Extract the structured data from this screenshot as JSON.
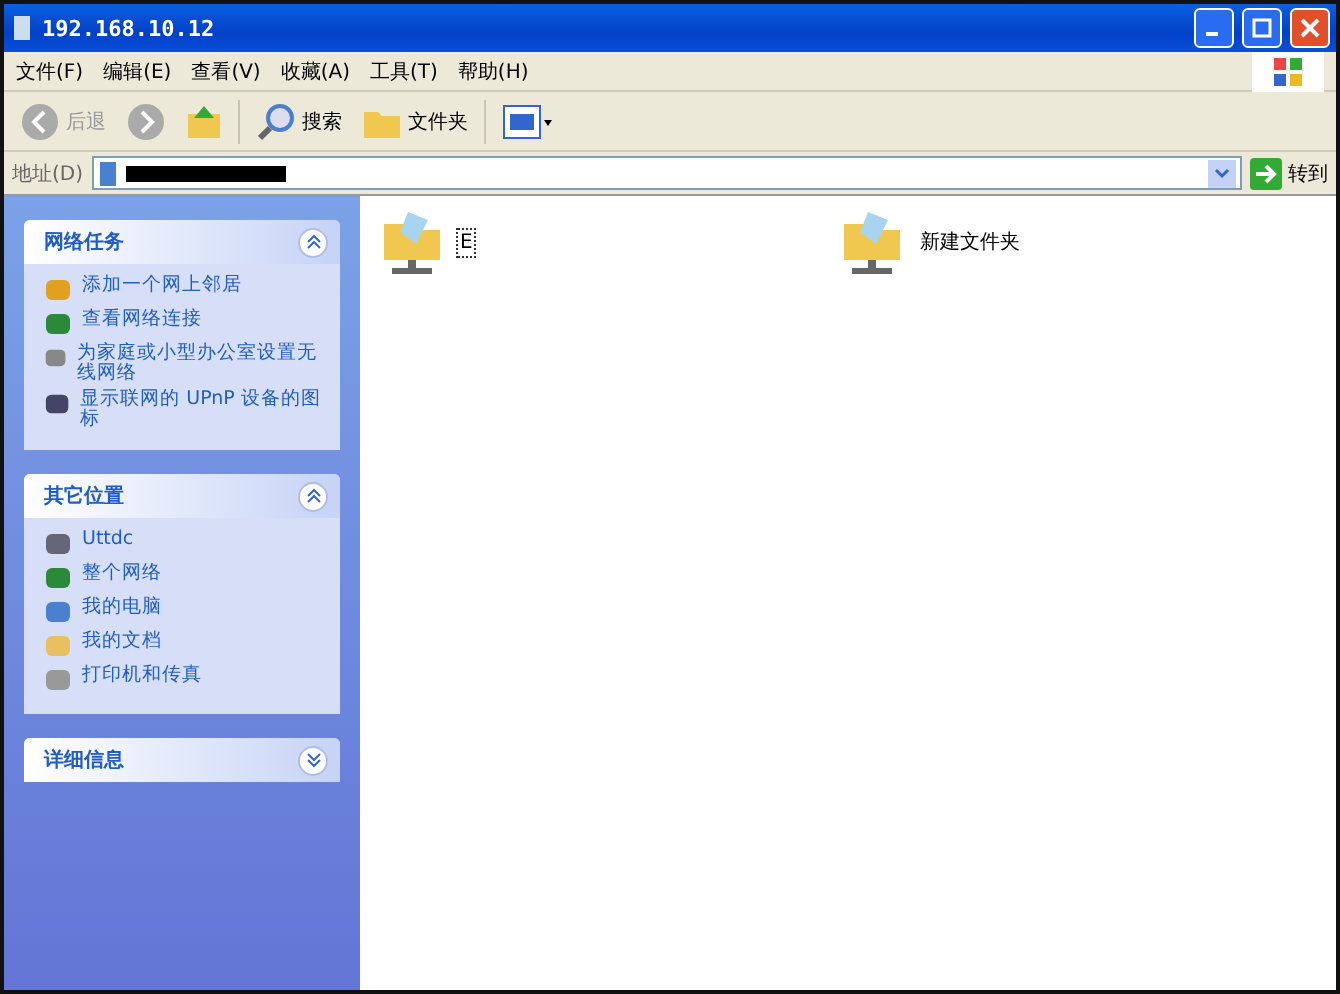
{
  "window": {
    "title": "192.168.10.12"
  },
  "menu": [
    "文件(F)",
    "编辑(E)",
    "查看(V)",
    "收藏(A)",
    "工具(T)",
    "帮助(H)"
  ],
  "toolbar": {
    "back": "后退",
    "search": "搜索",
    "folders": "文件夹"
  },
  "address": {
    "label": "地址(D)",
    "go": "转到"
  },
  "sidebar": [
    {
      "title": "网络任务",
      "expanded": true,
      "items": [
        {
          "label": "添加一个网上邻居"
        },
        {
          "label": "查看网络连接"
        },
        {
          "label": "为家庭或小型办公室设置无线网络"
        },
        {
          "label": "显示联网的 UPnP 设备的图标"
        }
      ]
    },
    {
      "title": "其它位置",
      "expanded": true,
      "items": [
        {
          "label": "Uttdc"
        },
        {
          "label": "整个网络"
        },
        {
          "label": "我的电脑"
        },
        {
          "label": "我的文档"
        },
        {
          "label": "打印机和传真"
        }
      ]
    },
    {
      "title": "详细信息",
      "expanded": false
    }
  ],
  "files": [
    {
      "name": "E",
      "selected": true
    },
    {
      "name": "新建文件夹",
      "selected": false
    }
  ]
}
